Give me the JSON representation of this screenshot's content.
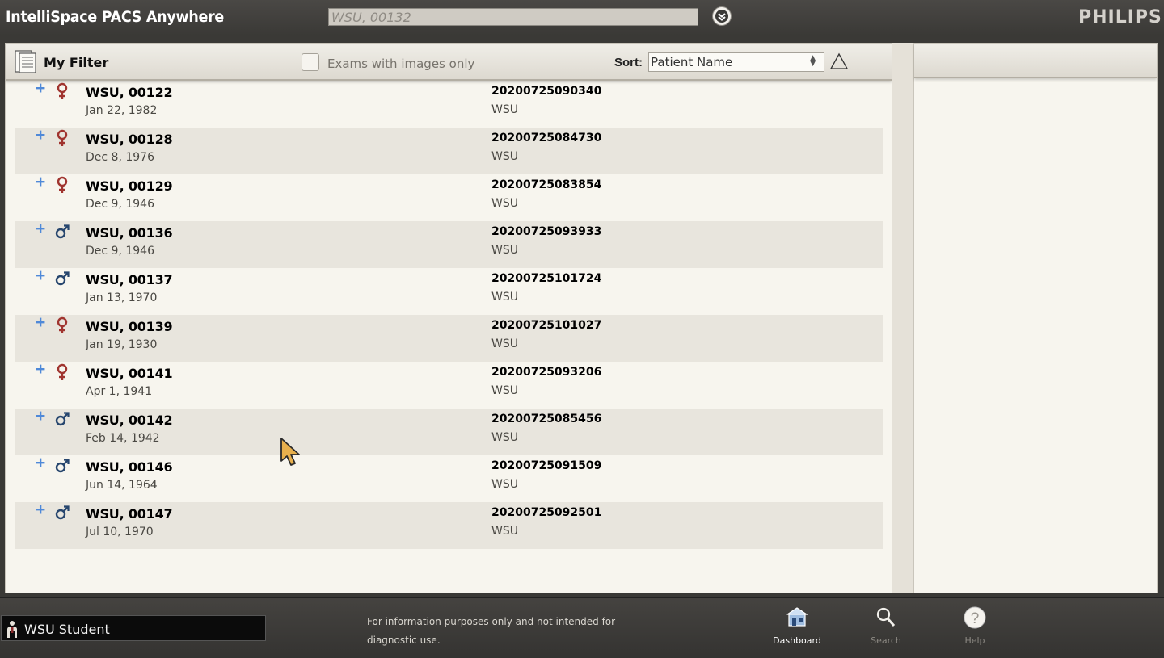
{
  "app": {
    "title": "IntelliSpace PACS Anywhere",
    "brand": "PHILIPS"
  },
  "search": {
    "value": "WSU, 00132",
    "dropdown_icon": "chevron-down-circle-icon"
  },
  "filter": {
    "title": "My Filter",
    "exam_images_only_label": "Exams with images only",
    "exam_images_only_checked": false,
    "sort_label": "Sort:",
    "sort_value": "Patient Name",
    "sort_direction": "ascending"
  },
  "patients": [
    {
      "name": "WSU, 00122",
      "dob": "Jan 22, 1982",
      "gender": "female",
      "exam_id": "20200725090340",
      "institution": "WSU"
    },
    {
      "name": "WSU, 00128",
      "dob": "Dec 8, 1976",
      "gender": "female",
      "exam_id": "20200725084730",
      "institution": "WSU"
    },
    {
      "name": "WSU, 00129",
      "dob": "Dec 9, 1946",
      "gender": "female",
      "exam_id": "20200725083854",
      "institution": "WSU"
    },
    {
      "name": "WSU, 00136",
      "dob": "Dec 9, 1946",
      "gender": "male",
      "exam_id": "20200725093933",
      "institution": "WSU"
    },
    {
      "name": "WSU, 00137",
      "dob": "Jan 13, 1970",
      "gender": "male",
      "exam_id": "20200725101724",
      "institution": "WSU"
    },
    {
      "name": "WSU, 00139",
      "dob": "Jan 19, 1930",
      "gender": "female",
      "exam_id": "20200725101027",
      "institution": "WSU"
    },
    {
      "name": "WSU, 00141",
      "dob": "Apr 1, 1941",
      "gender": "female",
      "exam_id": "20200725093206",
      "institution": "WSU"
    },
    {
      "name": "WSU, 00142",
      "dob": "Feb 14, 1942",
      "gender": "male",
      "exam_id": "20200725085456",
      "institution": "WSU"
    },
    {
      "name": "WSU, 00146",
      "dob": "Jun 14, 1964",
      "gender": "male",
      "exam_id": "20200725091509",
      "institution": "WSU"
    },
    {
      "name": "WSU, 00147",
      "dob": "Jul 10, 1970",
      "gender": "male",
      "exam_id": "20200725092501",
      "institution": "WSU"
    }
  ],
  "footer": {
    "user_name": "WSU Student",
    "disclaimer": "For information purposes only and not intended for diagnostic use.",
    "nav": {
      "dashboard": "Dashboard",
      "search": "Search",
      "help": "Help"
    }
  },
  "colors": {
    "female": "#a0342f",
    "male": "#27466e",
    "expand": "#4f89d8"
  }
}
